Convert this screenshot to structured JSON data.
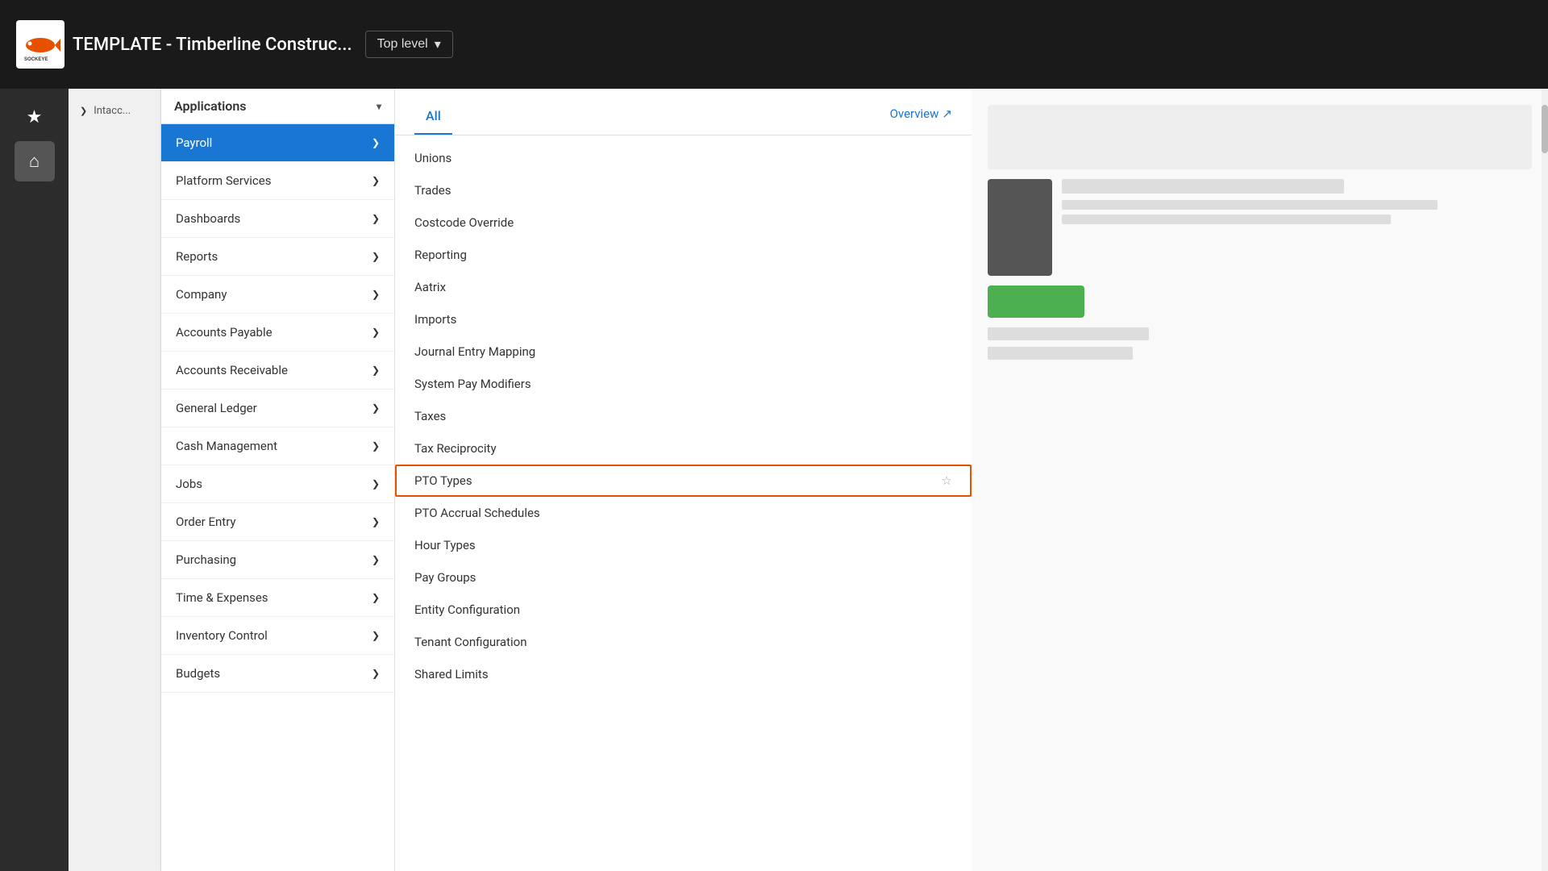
{
  "topbar": {
    "logo_text": "SOCKEYE",
    "company_title": "TEMPLATE - Timberline Construc...",
    "top_level_label": "Top level",
    "chevron": "▾"
  },
  "rail": {
    "icons": [
      {
        "name": "star-icon",
        "glyph": "★"
      },
      {
        "name": "home-icon",
        "glyph": "⌂"
      }
    ]
  },
  "sidebar": {
    "section_label": "Intacct",
    "chevron": "❯"
  },
  "apps_menu": {
    "header": "Applications",
    "chevron": "▾",
    "items": [
      {
        "label": "Payroll",
        "active": true,
        "arrow": "❯"
      },
      {
        "label": "Platform Services",
        "active": false,
        "arrow": "❯"
      },
      {
        "label": "Dashboards",
        "active": false,
        "arrow": "❯"
      },
      {
        "label": "Reports",
        "active": false,
        "arrow": "❯"
      },
      {
        "label": "Company",
        "active": false,
        "arrow": "❯"
      },
      {
        "label": "Accounts Payable",
        "active": false,
        "arrow": "❯"
      },
      {
        "label": "Accounts Receivable",
        "active": false,
        "arrow": "❯"
      },
      {
        "label": "General Ledger",
        "active": false,
        "arrow": "❯"
      },
      {
        "label": "Cash Management",
        "active": false,
        "arrow": "❯"
      },
      {
        "label": "Jobs",
        "active": false,
        "arrow": "❯"
      },
      {
        "label": "Order Entry",
        "active": false,
        "arrow": "❯"
      },
      {
        "label": "Purchasing",
        "active": false,
        "arrow": "❯"
      },
      {
        "label": "Time & Expenses",
        "active": false,
        "arrow": "❯"
      },
      {
        "label": "Inventory Control",
        "active": false,
        "arrow": "❯"
      },
      {
        "label": "Budgets",
        "active": false,
        "arrow": "❯"
      }
    ]
  },
  "submenu": {
    "tab_label": "All",
    "overview_label": "Overview",
    "overview_icon": "↗",
    "items": [
      {
        "label": "Unions",
        "highlighted": false
      },
      {
        "label": "Trades",
        "highlighted": false
      },
      {
        "label": "Costcode Override",
        "highlighted": false
      },
      {
        "label": "Reporting",
        "highlighted": false
      },
      {
        "label": "Aatrix",
        "highlighted": false
      },
      {
        "label": "Imports",
        "highlighted": false
      },
      {
        "label": "Journal Entry Mapping",
        "highlighted": false
      },
      {
        "label": "System Pay Modifiers",
        "highlighted": false
      },
      {
        "label": "Taxes",
        "highlighted": false
      },
      {
        "label": "Tax Reciprocity",
        "highlighted": false
      },
      {
        "label": "PTO Types",
        "highlighted": true,
        "show_star": true
      },
      {
        "label": "PTO Accrual Schedules",
        "highlighted": false
      },
      {
        "label": "Hour Types",
        "highlighted": false
      },
      {
        "label": "Pay Groups",
        "highlighted": false
      },
      {
        "label": "Entity Configuration",
        "highlighted": false
      },
      {
        "label": "Tenant Configuration",
        "highlighted": false
      },
      {
        "label": "Shared Limits",
        "highlighted": false
      }
    ]
  },
  "cursor": {
    "star_label": "☆"
  }
}
